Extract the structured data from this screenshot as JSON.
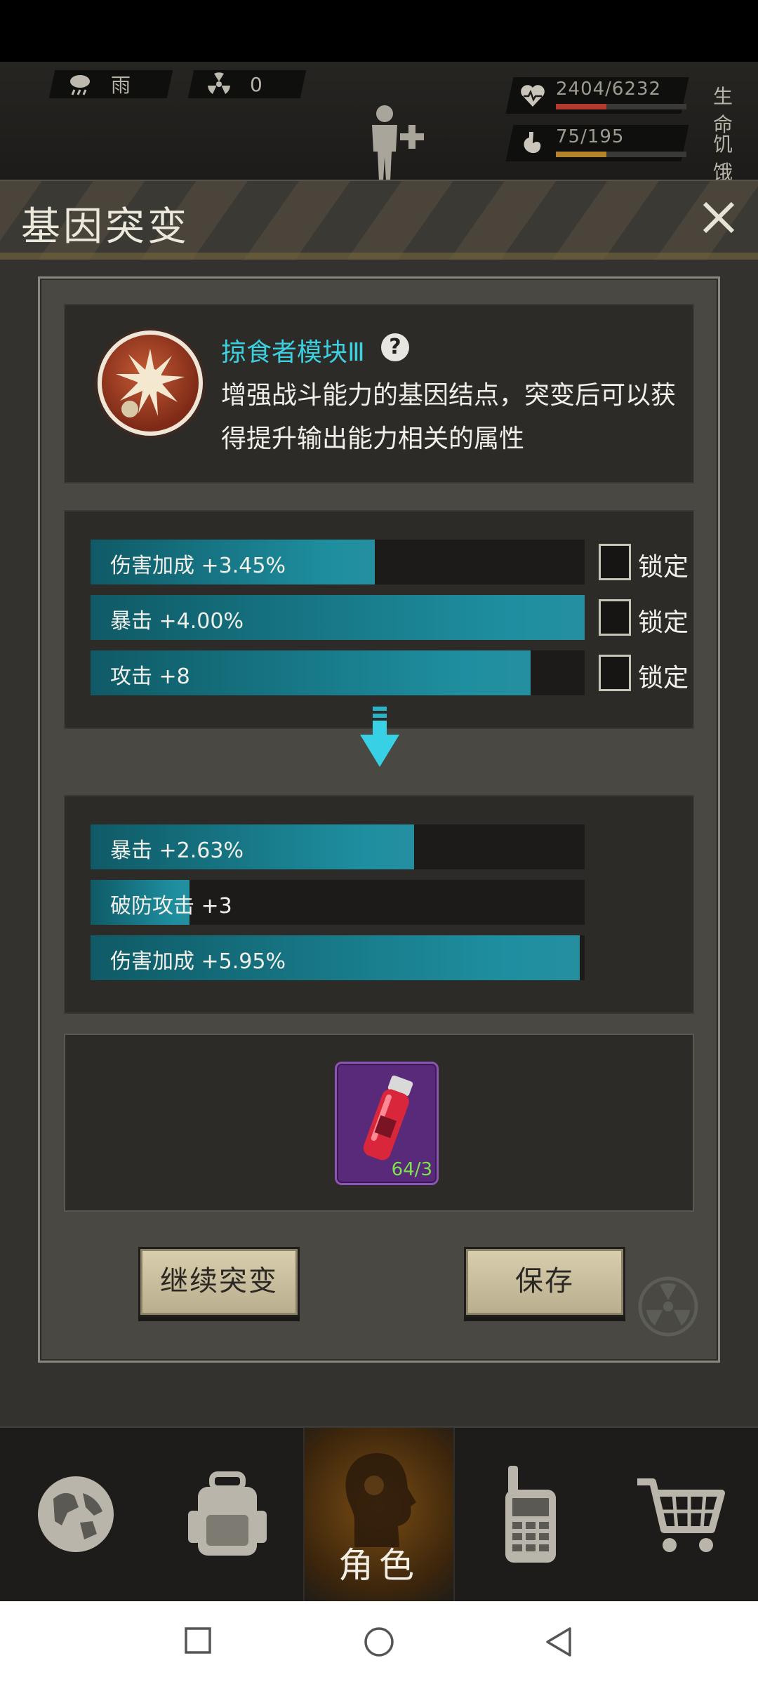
{
  "hud": {
    "weather_label": "雨",
    "radiation_value": "0",
    "health": {
      "text": "2404/6232",
      "label": "生命",
      "fraction": 0.386,
      "color": "#b23a2e"
    },
    "hunger": {
      "text": "75/195",
      "label": "饥饿",
      "fraction": 0.385,
      "color": "#b4842a"
    }
  },
  "dialog": {
    "title": "基因突变",
    "gene": {
      "name": "掠食者模块Ⅲ",
      "help": "?",
      "description": "增强战斗能力的基因结点，突变后可以获得提升输出能力相关的属性"
    },
    "current_attributes": [
      {
        "text": "伤害加成 +3.45%",
        "fill": 0.575,
        "lock_label": "锁定"
      },
      {
        "text": "暴击 +4.00%",
        "fill": 1.0,
        "lock_label": "锁定"
      },
      {
        "text": "攻击 +8",
        "fill": 0.89,
        "lock_label": "锁定"
      }
    ],
    "new_attributes": [
      {
        "text": "暴击 +2.63%",
        "fill": 0.655
      },
      {
        "text": "破防攻击 +3",
        "fill": 0.2
      },
      {
        "text": "伤害加成 +5.95%",
        "fill": 0.99
      }
    ],
    "item": {
      "count": "64/3",
      "icon": "serum-vial-icon"
    },
    "buttons": {
      "continue": "继续突变",
      "save": "保存"
    }
  },
  "nav": {
    "tabs": [
      {
        "icon": "globe-icon",
        "label": ""
      },
      {
        "icon": "backpack-icon",
        "label": ""
      },
      {
        "icon": "character-head-icon",
        "label": "角色"
      },
      {
        "icon": "walkie-talkie-icon",
        "label": ""
      },
      {
        "icon": "cart-icon",
        "label": ""
      }
    ],
    "active": 2
  },
  "colors": {
    "accent": "#3ccfe0",
    "bar": "#1e8fa0",
    "item_bg": "#5a2a7a"
  }
}
